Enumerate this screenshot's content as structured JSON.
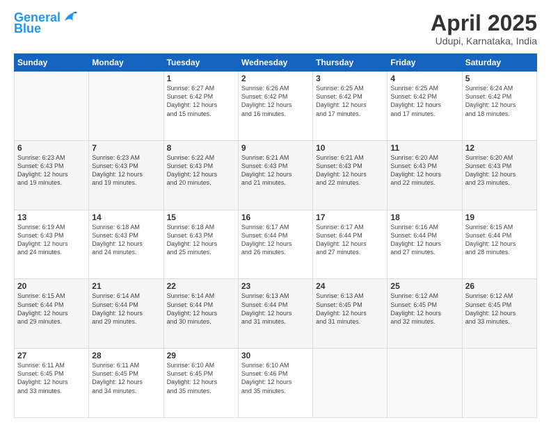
{
  "header": {
    "logo_line1": "General",
    "logo_line2": "Blue",
    "title": "April 2025",
    "subtitle": "Udupi, Karnataka, India"
  },
  "weekdays": [
    "Sunday",
    "Monday",
    "Tuesday",
    "Wednesday",
    "Thursday",
    "Friday",
    "Saturday"
  ],
  "weeks": [
    [
      {
        "day": "",
        "sunrise": "",
        "sunset": "",
        "daylight": ""
      },
      {
        "day": "",
        "sunrise": "",
        "sunset": "",
        "daylight": ""
      },
      {
        "day": "1",
        "sunrise": "Sunrise: 6:27 AM",
        "sunset": "Sunset: 6:42 PM",
        "daylight": "Daylight: 12 hours and 15 minutes."
      },
      {
        "day": "2",
        "sunrise": "Sunrise: 6:26 AM",
        "sunset": "Sunset: 6:42 PM",
        "daylight": "Daylight: 12 hours and 16 minutes."
      },
      {
        "day": "3",
        "sunrise": "Sunrise: 6:25 AM",
        "sunset": "Sunset: 6:42 PM",
        "daylight": "Daylight: 12 hours and 17 minutes."
      },
      {
        "day": "4",
        "sunrise": "Sunrise: 6:25 AM",
        "sunset": "Sunset: 6:42 PM",
        "daylight": "Daylight: 12 hours and 17 minutes."
      },
      {
        "day": "5",
        "sunrise": "Sunrise: 6:24 AM",
        "sunset": "Sunset: 6:42 PM",
        "daylight": "Daylight: 12 hours and 18 minutes."
      }
    ],
    [
      {
        "day": "6",
        "sunrise": "Sunrise: 6:23 AM",
        "sunset": "Sunset: 6:43 PM",
        "daylight": "Daylight: 12 hours and 19 minutes."
      },
      {
        "day": "7",
        "sunrise": "Sunrise: 6:23 AM",
        "sunset": "Sunset: 6:43 PM",
        "daylight": "Daylight: 12 hours and 19 minutes."
      },
      {
        "day": "8",
        "sunrise": "Sunrise: 6:22 AM",
        "sunset": "Sunset: 6:43 PM",
        "daylight": "Daylight: 12 hours and 20 minutes."
      },
      {
        "day": "9",
        "sunrise": "Sunrise: 6:21 AM",
        "sunset": "Sunset: 6:43 PM",
        "daylight": "Daylight: 12 hours and 21 minutes."
      },
      {
        "day": "10",
        "sunrise": "Sunrise: 6:21 AM",
        "sunset": "Sunset: 6:43 PM",
        "daylight": "Daylight: 12 hours and 22 minutes."
      },
      {
        "day": "11",
        "sunrise": "Sunrise: 6:20 AM",
        "sunset": "Sunset: 6:43 PM",
        "daylight": "Daylight: 12 hours and 22 minutes."
      },
      {
        "day": "12",
        "sunrise": "Sunrise: 6:20 AM",
        "sunset": "Sunset: 6:43 PM",
        "daylight": "Daylight: 12 hours and 23 minutes."
      }
    ],
    [
      {
        "day": "13",
        "sunrise": "Sunrise: 6:19 AM",
        "sunset": "Sunset: 6:43 PM",
        "daylight": "Daylight: 12 hours and 24 minutes."
      },
      {
        "day": "14",
        "sunrise": "Sunrise: 6:18 AM",
        "sunset": "Sunset: 6:43 PM",
        "daylight": "Daylight: 12 hours and 24 minutes."
      },
      {
        "day": "15",
        "sunrise": "Sunrise: 6:18 AM",
        "sunset": "Sunset: 6:43 PM",
        "daylight": "Daylight: 12 hours and 25 minutes."
      },
      {
        "day": "16",
        "sunrise": "Sunrise: 6:17 AM",
        "sunset": "Sunset: 6:44 PM",
        "daylight": "Daylight: 12 hours and 26 minutes."
      },
      {
        "day": "17",
        "sunrise": "Sunrise: 6:17 AM",
        "sunset": "Sunset: 6:44 PM",
        "daylight": "Daylight: 12 hours and 27 minutes."
      },
      {
        "day": "18",
        "sunrise": "Sunrise: 6:16 AM",
        "sunset": "Sunset: 6:44 PM",
        "daylight": "Daylight: 12 hours and 27 minutes."
      },
      {
        "day": "19",
        "sunrise": "Sunrise: 6:15 AM",
        "sunset": "Sunset: 6:44 PM",
        "daylight": "Daylight: 12 hours and 28 minutes."
      }
    ],
    [
      {
        "day": "20",
        "sunrise": "Sunrise: 6:15 AM",
        "sunset": "Sunset: 6:44 PM",
        "daylight": "Daylight: 12 hours and 29 minutes."
      },
      {
        "day": "21",
        "sunrise": "Sunrise: 6:14 AM",
        "sunset": "Sunset: 6:44 PM",
        "daylight": "Daylight: 12 hours and 29 minutes."
      },
      {
        "day": "22",
        "sunrise": "Sunrise: 6:14 AM",
        "sunset": "Sunset: 6:44 PM",
        "daylight": "Daylight: 12 hours and 30 minutes."
      },
      {
        "day": "23",
        "sunrise": "Sunrise: 6:13 AM",
        "sunset": "Sunset: 6:44 PM",
        "daylight": "Daylight: 12 hours and 31 minutes."
      },
      {
        "day": "24",
        "sunrise": "Sunrise: 6:13 AM",
        "sunset": "Sunset: 6:45 PM",
        "daylight": "Daylight: 12 hours and 31 minutes."
      },
      {
        "day": "25",
        "sunrise": "Sunrise: 6:12 AM",
        "sunset": "Sunset: 6:45 PM",
        "daylight": "Daylight: 12 hours and 32 minutes."
      },
      {
        "day": "26",
        "sunrise": "Sunrise: 6:12 AM",
        "sunset": "Sunset: 6:45 PM",
        "daylight": "Daylight: 12 hours and 33 minutes."
      }
    ],
    [
      {
        "day": "27",
        "sunrise": "Sunrise: 6:11 AM",
        "sunset": "Sunset: 6:45 PM",
        "daylight": "Daylight: 12 hours and 33 minutes."
      },
      {
        "day": "28",
        "sunrise": "Sunrise: 6:11 AM",
        "sunset": "Sunset: 6:45 PM",
        "daylight": "Daylight: 12 hours and 34 minutes."
      },
      {
        "day": "29",
        "sunrise": "Sunrise: 6:10 AM",
        "sunset": "Sunset: 6:45 PM",
        "daylight": "Daylight: 12 hours and 35 minutes."
      },
      {
        "day": "30",
        "sunrise": "Sunrise: 6:10 AM",
        "sunset": "Sunset: 6:46 PM",
        "daylight": "Daylight: 12 hours and 35 minutes."
      },
      {
        "day": "",
        "sunrise": "",
        "sunset": "",
        "daylight": ""
      },
      {
        "day": "",
        "sunrise": "",
        "sunset": "",
        "daylight": ""
      },
      {
        "day": "",
        "sunrise": "",
        "sunset": "",
        "daylight": ""
      }
    ]
  ]
}
